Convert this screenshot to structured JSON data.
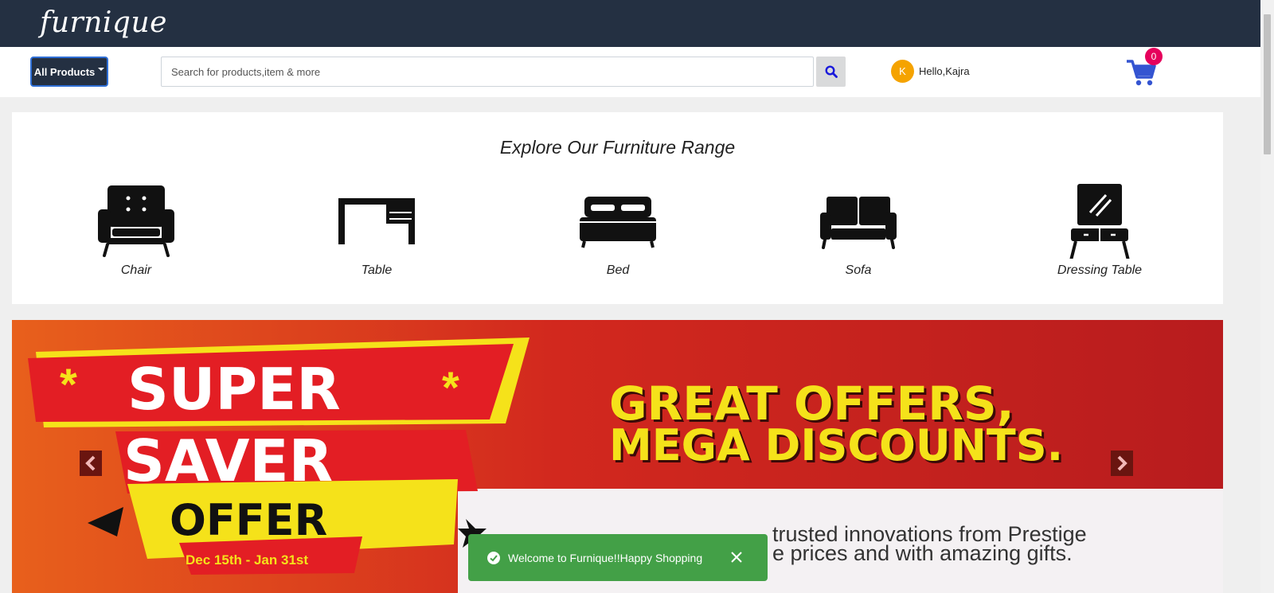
{
  "header": {
    "logo_text": "furnique"
  },
  "toolbar": {
    "all_products_label": "All Products",
    "search_placeholder": "Search for products,item & more",
    "search_value": "",
    "user_initial": "K",
    "user_greeting": "Hello,Kajra",
    "cart_count": "0"
  },
  "range": {
    "title": "Explore Our Furniture Range",
    "categories": [
      {
        "label": "Chair",
        "icon": "armchair-icon"
      },
      {
        "label": "Table",
        "icon": "desk-icon"
      },
      {
        "label": "Bed",
        "icon": "bed-icon"
      },
      {
        "label": "Sofa",
        "icon": "sofa-icon"
      },
      {
        "label": "Dressing Table",
        "icon": "dressing-table-icon"
      }
    ]
  },
  "banner": {
    "line1": "SUPER",
    "line2": "SAVER",
    "line3": "OFFER",
    "dates": "Dec 15th - Jan 31st",
    "headline1": "GREAT OFFERS,",
    "headline2": "MEGA DISCOUNTS.",
    "sub1": "trusted innovations from Prestige",
    "sub2": "e prices and with amazing gifts."
  },
  "toast": {
    "message": "Welcome to Furnique!!Happy Shopping"
  },
  "colors": {
    "navbar": "#243042",
    "accent_blue": "#2f6fd6",
    "badge": "#e6005c",
    "avatar": "#f5a300",
    "banner_red": "#c8201e",
    "banner_yellow": "#f5e21a",
    "toast_green": "#43a047"
  }
}
